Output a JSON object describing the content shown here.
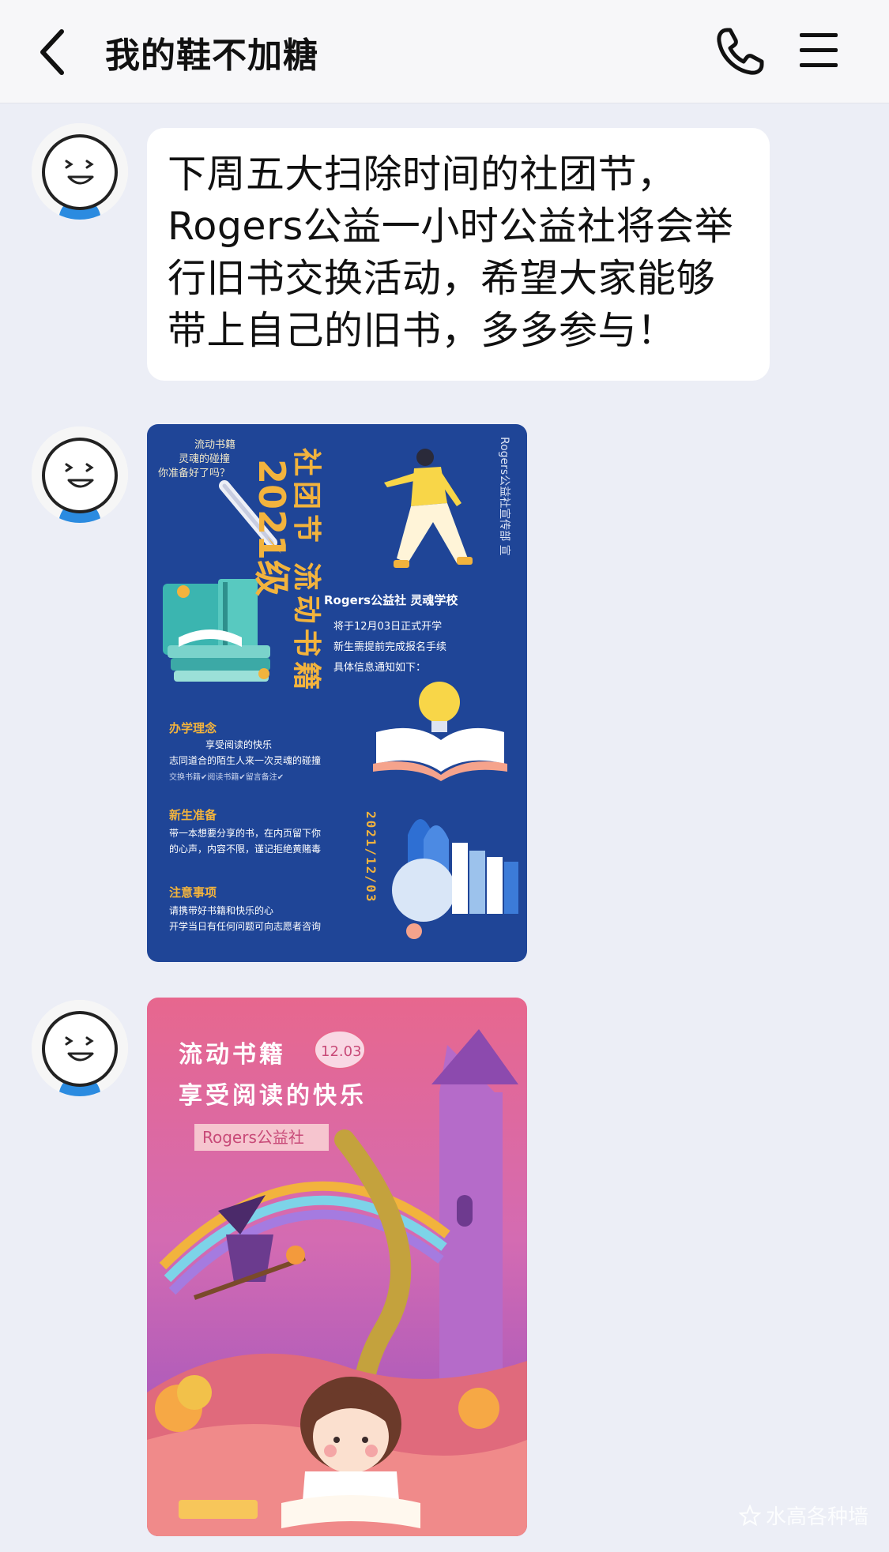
{
  "header": {
    "title": "我的鞋不加糖",
    "back_icon": "chevron-left-icon",
    "call_icon": "phone-icon",
    "menu_icon": "hamburger-menu-icon"
  },
  "messages": [
    {
      "type": "text",
      "text": "下周五大扫除时间的社团节，Rogers公益一小时公益社将会举行旧书交换活动，希望大家能够带上自己的旧书，多多参与！"
    },
    {
      "type": "image",
      "poster": {
        "side_note": "Rogers公益社宣传部 宣",
        "slogan_lines": [
          "流动书籍",
          "灵魂的碰撞",
          "你准备好了吗？"
        ],
        "year_label": "2021级",
        "title": "社团节 流动书籍",
        "org_line": "Rogers公益社  灵魂学校",
        "info_lines": [
          "将于12月03日正式开学",
          "新生需提前完成报名手续",
          "具体信息通知如下："
        ],
        "section1_title": "办学理念",
        "section1_lines": [
          "享受阅读的快乐",
          "志同道合的陌生人来一次灵魂的碰撞",
          "交换书籍✔阅读书籍✔留言备注✔"
        ],
        "section2_title": "新生准备",
        "section2_lines": [
          "带一本想要分享的书，在内页留下你",
          "的心声，内容不限，谨记拒绝黄赌毒"
        ],
        "section3_title": "注意事项",
        "section3_lines": [
          "请携带好书籍和快乐的心",
          "开学当日有任何问题可向志愿者咨询"
        ],
        "date_vertical": "2021/12/03"
      }
    },
    {
      "type": "image",
      "poster": {
        "line1": "流动书籍",
        "date_badge": "12.03",
        "line2": "享受阅读的快乐",
        "tag": "Rogers公益社"
      }
    }
  ],
  "watermark": "水高各种墙",
  "colors": {
    "background": "#ECEEF6",
    "header": "#F7F7F9",
    "poster_blue": "#1F4597",
    "poster_gold": "#F2B33D",
    "poster_pink": "#E7678E"
  }
}
